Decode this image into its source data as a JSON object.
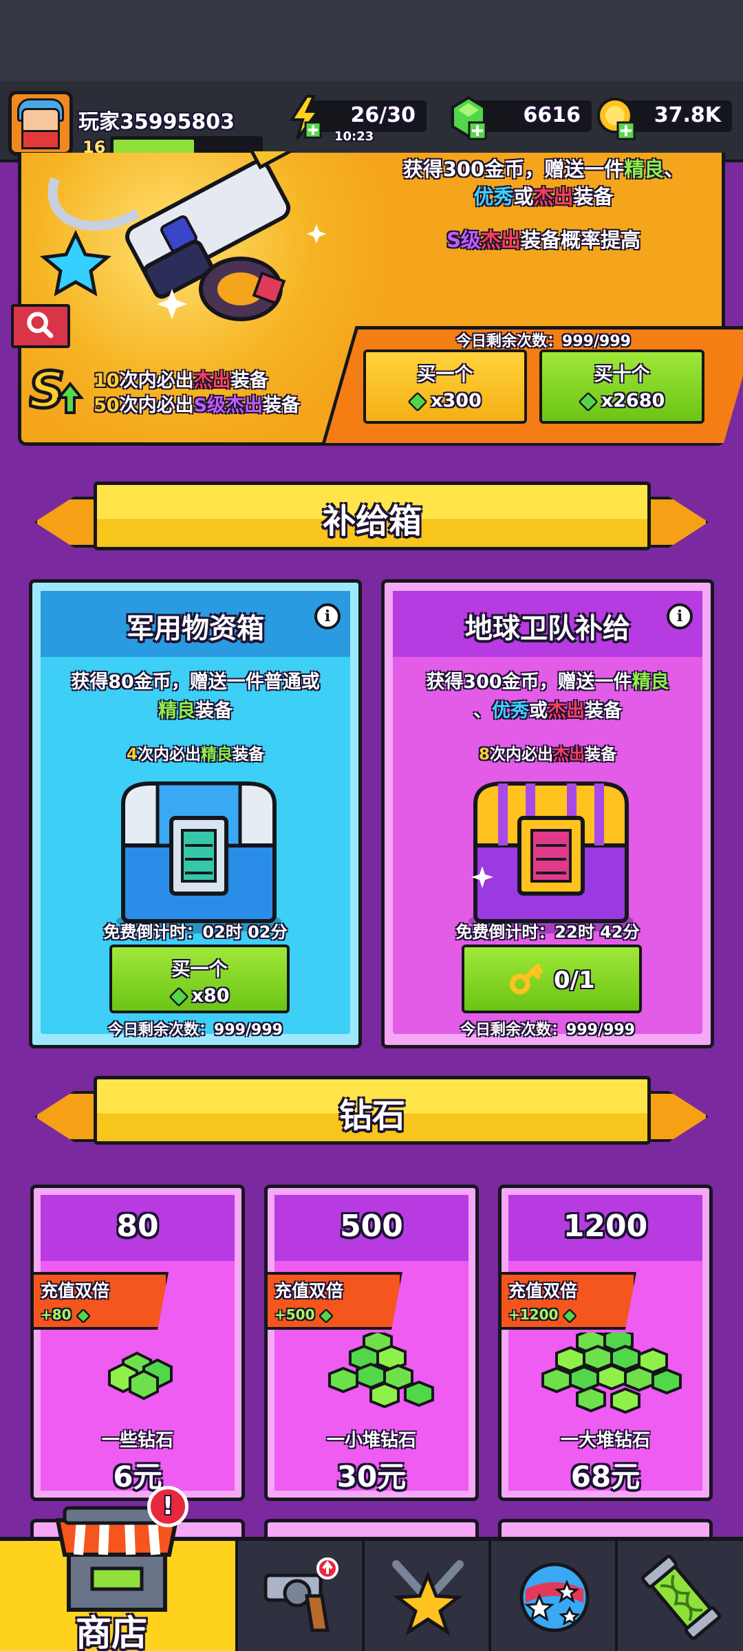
{
  "player": {
    "name": "玩家35995803",
    "level": "16",
    "xp_fraction": 0.55
  },
  "resources": {
    "energy": "26/30",
    "energy_timer": "10:23",
    "gems": "6616",
    "coins": "37.8K"
  },
  "banner": {
    "desc_prefix": "获得300金币，赠送一件",
    "desc_fine": "精良",
    "desc_sep": "、",
    "desc_excellent": "优秀",
    "desc_or": "或",
    "desc_outstanding": "杰出",
    "desc_suffix": "装备",
    "prob_grade": "S级",
    "prob_outstanding": "杰出",
    "prob_suffix": "装备概率提高",
    "remaining": "今日剩余次数：999/999",
    "pity_1_num": "10",
    "pity_1_mid": "次内必出",
    "pity_1_grade": "杰出",
    "pity_1_suffix": "装备",
    "pity_2_num": "50",
    "pity_2_mid": "次内必出",
    "pity_2_grade": "S级杰出",
    "pity_2_suffix": "装备",
    "buy_one": {
      "label": "买一个",
      "cost": "x300"
    },
    "buy_ten": {
      "label": "买十个",
      "cost": "x2680"
    }
  },
  "supply_section": {
    "title": "补给箱"
  },
  "supply_cards": [
    {
      "title": "军用物资箱",
      "desc_prefix": "获得80金币，赠送一件普通或",
      "desc_fine": "精良",
      "desc_suffix": "装备",
      "pity_num": "4",
      "pity_mid": "次内必出",
      "pity_grade": "精良",
      "pity_suffix": "装备",
      "timer": "免费倒计时：02时 02分",
      "button_label": "买一个",
      "button_cost": "x80",
      "remaining": "今日剩余次数：999/999"
    },
    {
      "title": "地球卫队补给",
      "desc_prefix": "获得300金币，赠送一件",
      "desc_fine": "精良",
      "desc_sep": "、",
      "desc_excellent": "优秀",
      "desc_or": "或",
      "desc_outstanding": "杰出",
      "desc_suffix": "装备",
      "pity_num": "8",
      "pity_mid": "次内必出",
      "pity_grade": "杰出",
      "pity_suffix": "装备",
      "timer": "免费倒计时：22时 42分",
      "button_keys": "0/1",
      "remaining": "今日剩余次数：999/999"
    }
  ],
  "gem_section": {
    "title": "钻石"
  },
  "gem_packs": [
    {
      "amount": "80",
      "tag": "充值双倍",
      "bonus": "+80",
      "name": "一些钻石",
      "price": "6元"
    },
    {
      "amount": "500",
      "tag": "充值双倍",
      "bonus": "+500",
      "name": "一小堆钻石",
      "price": "30元"
    },
    {
      "amount": "1200",
      "tag": "充值双倍",
      "bonus": "+1200",
      "name": "一大堆钻石",
      "price": "68元"
    }
  ],
  "nav": {
    "shop_label": "商店",
    "alert": "!"
  },
  "colors": {
    "background": "#7a2a9e",
    "fine": "#8ff04a",
    "excellent": "#3fd0ff",
    "outstanding": "#ff3d5a",
    "s_grade": "#c15cff"
  }
}
